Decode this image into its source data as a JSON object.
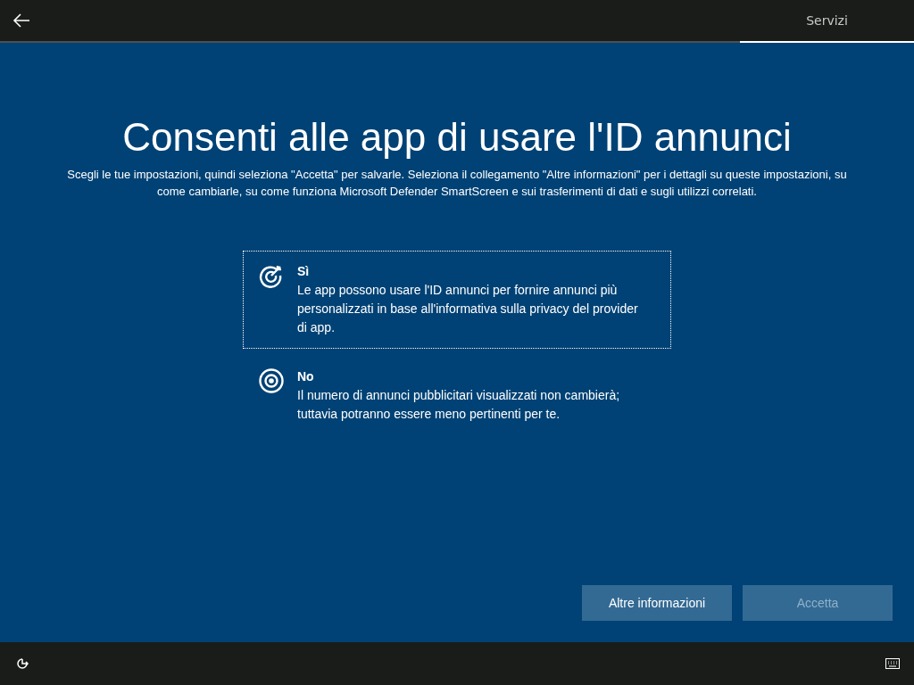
{
  "top_bar": {
    "tabs": [
      {
        "label": "Servizi",
        "selected": true
      }
    ]
  },
  "title": "Consenti alle app di usare l'ID annunci",
  "description": "Scegli le tue impostazioni, quindi seleziona \"Accetta\" per salvarle. Seleziona il collegamento \"Altre informazioni\" per i dettagli su queste impostazioni, su come cambiarle, su come funziona Microsoft Defender SmartScreen e sui trasferimenti di dati e sugli utilizzi correlati.",
  "options": [
    {
      "kind": "target-arrow",
      "title": "Sì",
      "text": "Le app possono usare l'ID annunci per fornire annunci più personalizzati in base all'informativa sulla privacy del provider di app.",
      "focused": true
    },
    {
      "kind": "target",
      "title": "No",
      "text": "Il numero di annunci pubblicitari visualizzati non cambierà; tuttavia potranno essere meno pertinenti per te.",
      "focused": false
    }
  ],
  "buttons": [
    {
      "label": "Altre informazioni",
      "disabled": false
    },
    {
      "label": "Accetta",
      "disabled": true
    }
  ]
}
